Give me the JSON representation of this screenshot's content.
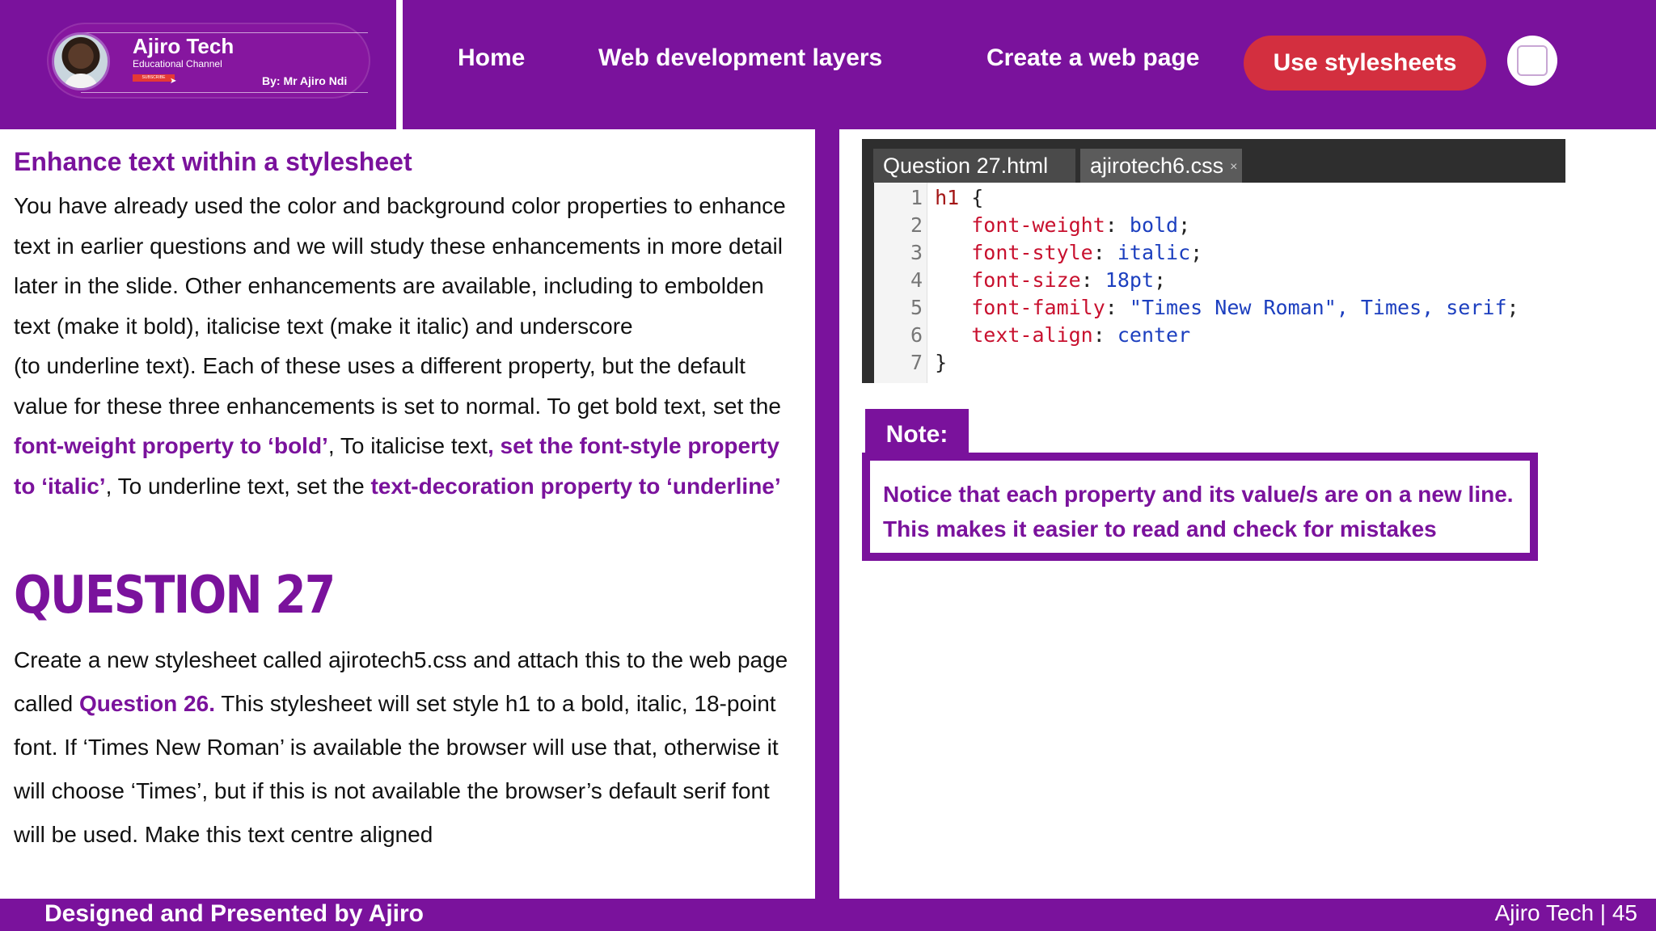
{
  "brand": {
    "title": "Ajiro Tech",
    "subtitle": "Educational Channel",
    "subscribe": "SUBSCRIBE",
    "byline": "By: Mr Ajiro Ndi"
  },
  "nav": {
    "items": [
      {
        "label": "Home"
      },
      {
        "label": "Web development layers"
      },
      {
        "label": "Create a web page"
      },
      {
        "label": "Use stylesheets"
      }
    ],
    "active_color": "#d32f3f"
  },
  "left": {
    "heading": "Enhance text within a stylesheet",
    "para": {
      "p1": "You have already used the color and background  color properties to enhance text in earlier questions and we will study these enhancements in more detail later in the slide. Other enhancements are available, including to embolden text (make it bold), italicise text (make it italic) and underscore",
      "p2": "(to underline text). Each of these uses a different property, but the default value for these three enhancements is set to normal. To get bold text, set the ",
      "hl1": "font-weight property to ‘bold’",
      "t2": ", To italicise text",
      "hl2": ", set the font-style property to ‘italic’",
      "t3": ", To underline text, set the ",
      "hl3": "text-decoration property to ‘underline’"
    },
    "question_title": "QUESTION 27",
    "question": {
      "t1": "Create a new stylesheet called ajirotech5.css and attach this to the web page called ",
      "hl": "Question 26.",
      "t2": " This stylesheet will set style h1 to a bold, italic, 18-point font. If ‘Times New Roman’ is available the browser will use that, otherwise it will choose ‘Times’, but if this is not available the browser’s default serif font will be used. Make this text centre aligned"
    }
  },
  "editor": {
    "tabs": [
      {
        "label": "Question 27.html"
      },
      {
        "label": "ajirotech6.css",
        "close": "×"
      }
    ],
    "lines": [
      {
        "n": "1",
        "sel": "h1",
        "rest": " {"
      },
      {
        "n": "2",
        "prop": "font-weight",
        "val": "bold",
        "end": ";"
      },
      {
        "n": "3",
        "prop": "font-style",
        "val": "italic",
        "end": ";"
      },
      {
        "n": "4",
        "prop": "font-size",
        "val": "18pt",
        "end": ";"
      },
      {
        "n": "5",
        "prop": "font-family",
        "val": "\"Times New Roman\", Times, serif",
        "end": ";"
      },
      {
        "n": "6",
        "prop": "text-align",
        "val": "center",
        "end": ""
      },
      {
        "n": "7",
        "close": "}"
      }
    ]
  },
  "note": {
    "label": "Note:",
    "text_1": "Notice that each property and its value/s are on a new line.",
    "text_2": "This makes it easier to read and check for mistakes"
  },
  "footer": {
    "left": "Designed and Presented by Ajiro",
    "right": "Ajiro Tech | 45"
  },
  "colors": {
    "brand_purple": "#7a129c",
    "accent_red": "#d32f3f"
  }
}
